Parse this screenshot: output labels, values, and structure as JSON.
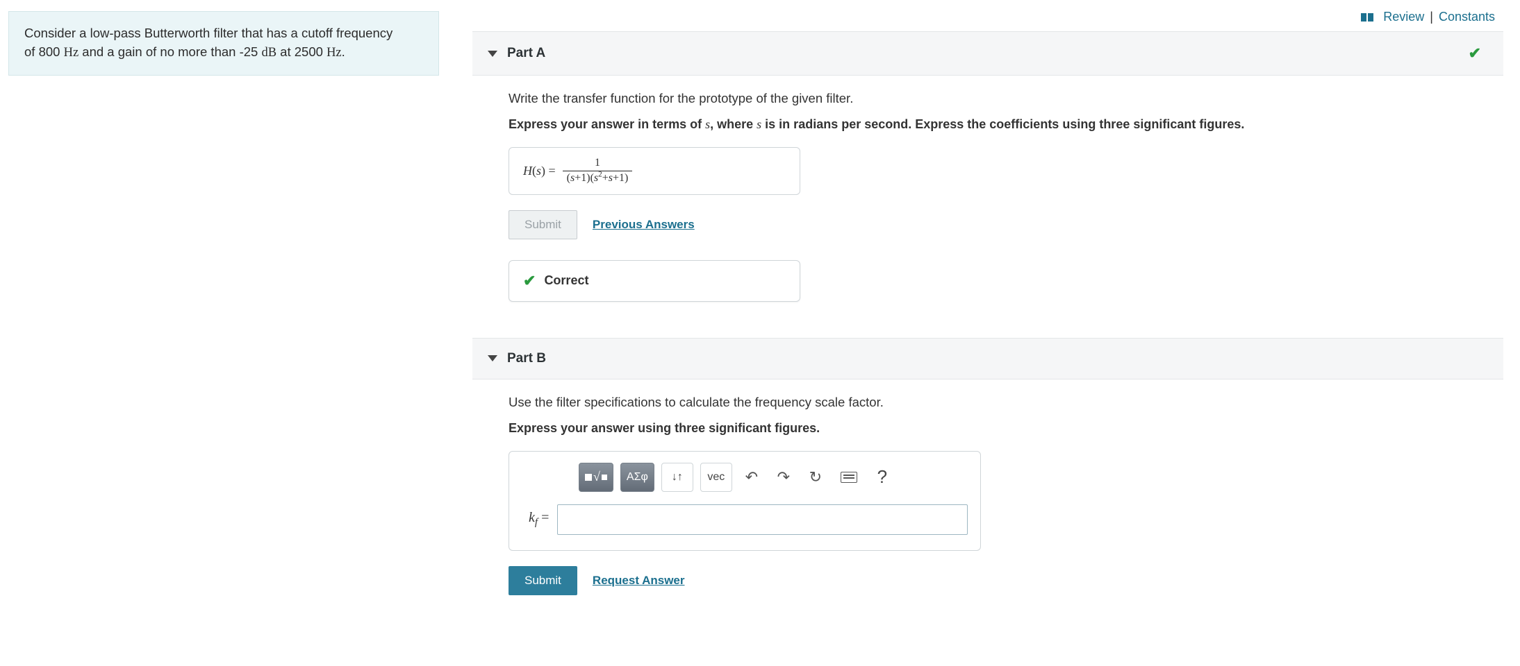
{
  "top_links": {
    "review": "Review",
    "separator": "|",
    "constants": "Constants"
  },
  "problem_statement": {
    "line1_a": "Consider a low-pass Butterworth filter that has a cutoff frequency",
    "line1_b": "of 800",
    "unit_hz1": "Hz",
    "line1_c": " and a gain of no more than -25 ",
    "unit_db": "dB",
    "line1_d": " at 2500 ",
    "unit_hz2": "Hz",
    "line1_e": "."
  },
  "partA": {
    "title": "Part A",
    "prompt": "Write the transfer function for the prototype of the given filter.",
    "instruction_a": "Express your answer in terms of ",
    "instruction_var": "s",
    "instruction_b": ", where ",
    "instruction_c": " is in radians per second. Express the coefficients using three significant figures.",
    "result_lhs_a": "H",
    "result_lhs_b": "(",
    "result_lhs_var": "s",
    "result_lhs_c": ") =",
    "result_num": "1",
    "result_den": "(s+1)(s²+s+1)",
    "submit": "Submit",
    "previous_answers": "Previous Answers",
    "feedback": "Correct"
  },
  "partB": {
    "title": "Part B",
    "prompt": "Use the filter specifications to calculate the frequency scale factor.",
    "instruction": "Express your answer using three significant figures.",
    "toolbar": {
      "greek": "ΑΣφ",
      "updown": "↓↑",
      "vec": "vec",
      "undo": "↶",
      "redo": "↷",
      "reset": "↻",
      "help": "?"
    },
    "var_label_k": "k",
    "var_label_f": "f",
    "equals": " =",
    "input_value": "",
    "submit": "Submit",
    "request_answer": "Request Answer"
  }
}
